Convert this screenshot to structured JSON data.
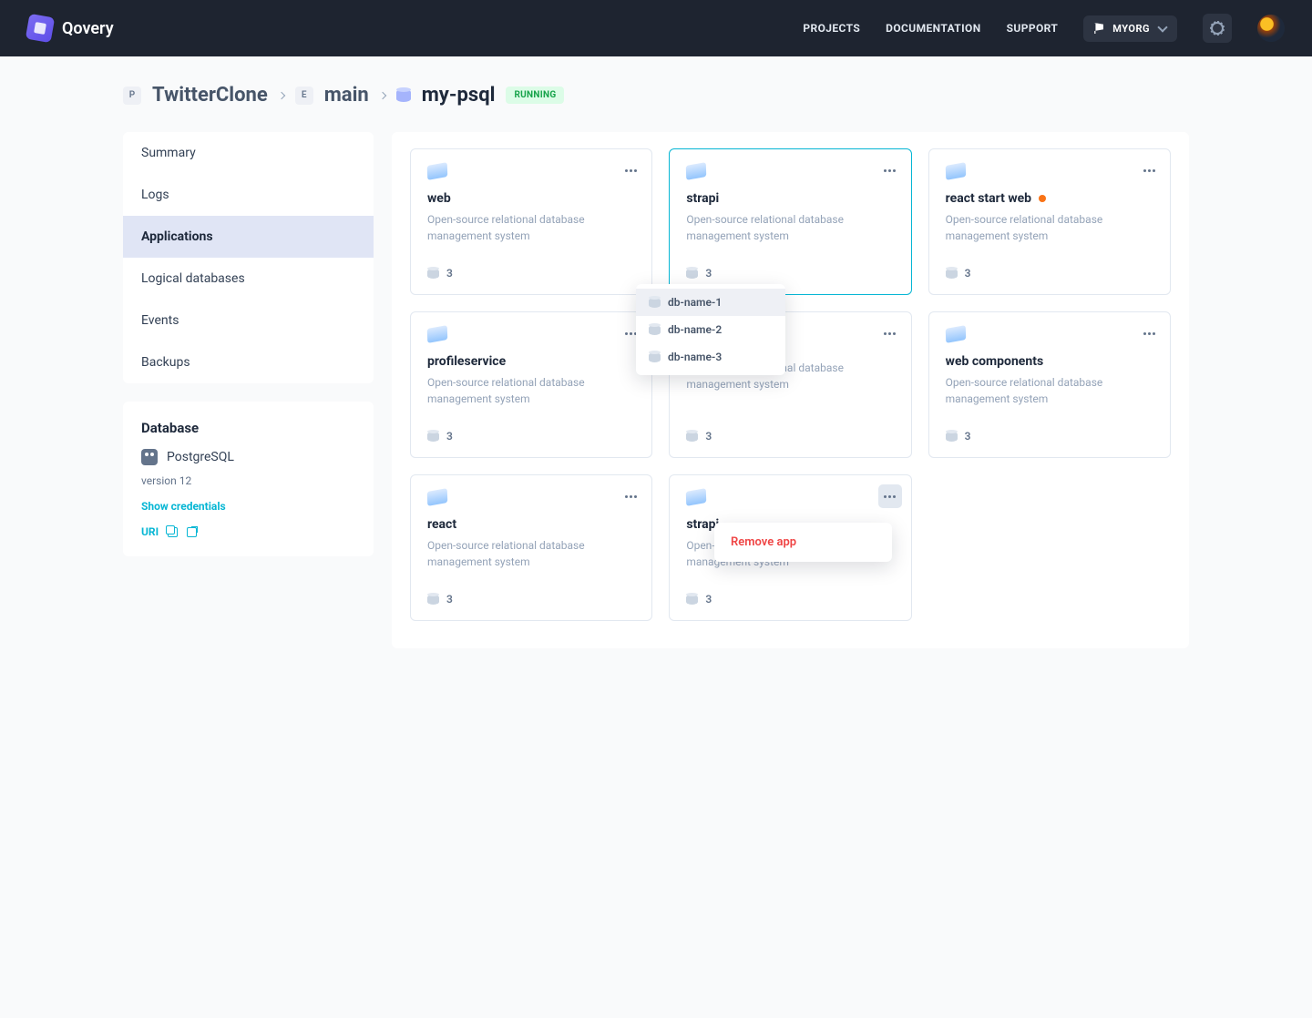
{
  "brand": "Qovery",
  "nav": {
    "projects": "PROJECTS",
    "documentation": "DOCUMENTATION",
    "support": "SUPPORT",
    "org": "MYORG"
  },
  "breadcrumbs": {
    "p_badge": "P",
    "project": "TwitterClone",
    "e_badge": "E",
    "env": "main",
    "db": "my-psql",
    "status": "RUNNING"
  },
  "sidebar": {
    "items": [
      {
        "label": "Summary"
      },
      {
        "label": "Logs"
      },
      {
        "label": "Applications"
      },
      {
        "label": "Logical databases"
      },
      {
        "label": "Events"
      },
      {
        "label": "Backups"
      }
    ]
  },
  "database_panel": {
    "heading": "Database",
    "engine": "PostgreSQL",
    "version": "version 12",
    "show_cred": "Show credentials",
    "uri": "URI"
  },
  "apps": [
    {
      "name": "web",
      "desc": "Open-source relational database management system",
      "count": "3"
    },
    {
      "name": "strapi",
      "desc": "Open-source relational database management system",
      "count": "3"
    },
    {
      "name": "react start web",
      "desc": "Open-source relational database management system",
      "count": "3",
      "status": "orange"
    },
    {
      "name": "profileservice",
      "desc": "Open-source relational database management system",
      "count": "3"
    },
    {
      "name": "",
      "desc": "Open-source relational database management system",
      "count": "3"
    },
    {
      "name": "web components",
      "desc": "Open-source relational database management system",
      "count": "3"
    },
    {
      "name": "react",
      "desc": "Open-source relational database management system",
      "count": "3"
    },
    {
      "name": "strapi",
      "desc": "Open-source relational database management system",
      "count": "3"
    }
  ],
  "db_popover": {
    "items": [
      {
        "label": "db-name-1"
      },
      {
        "label": "db-name-2"
      },
      {
        "label": "db-name-3"
      }
    ]
  },
  "context_menu": {
    "remove": "Remove app"
  }
}
